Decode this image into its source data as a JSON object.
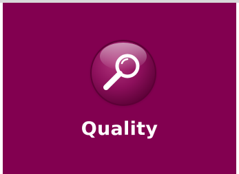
{
  "tile": {
    "label": "Quality",
    "icon": "magnifying-glass-icon",
    "background_color": "#820050",
    "orb_color": "#9a1a63",
    "text_color": "#ffffff"
  }
}
